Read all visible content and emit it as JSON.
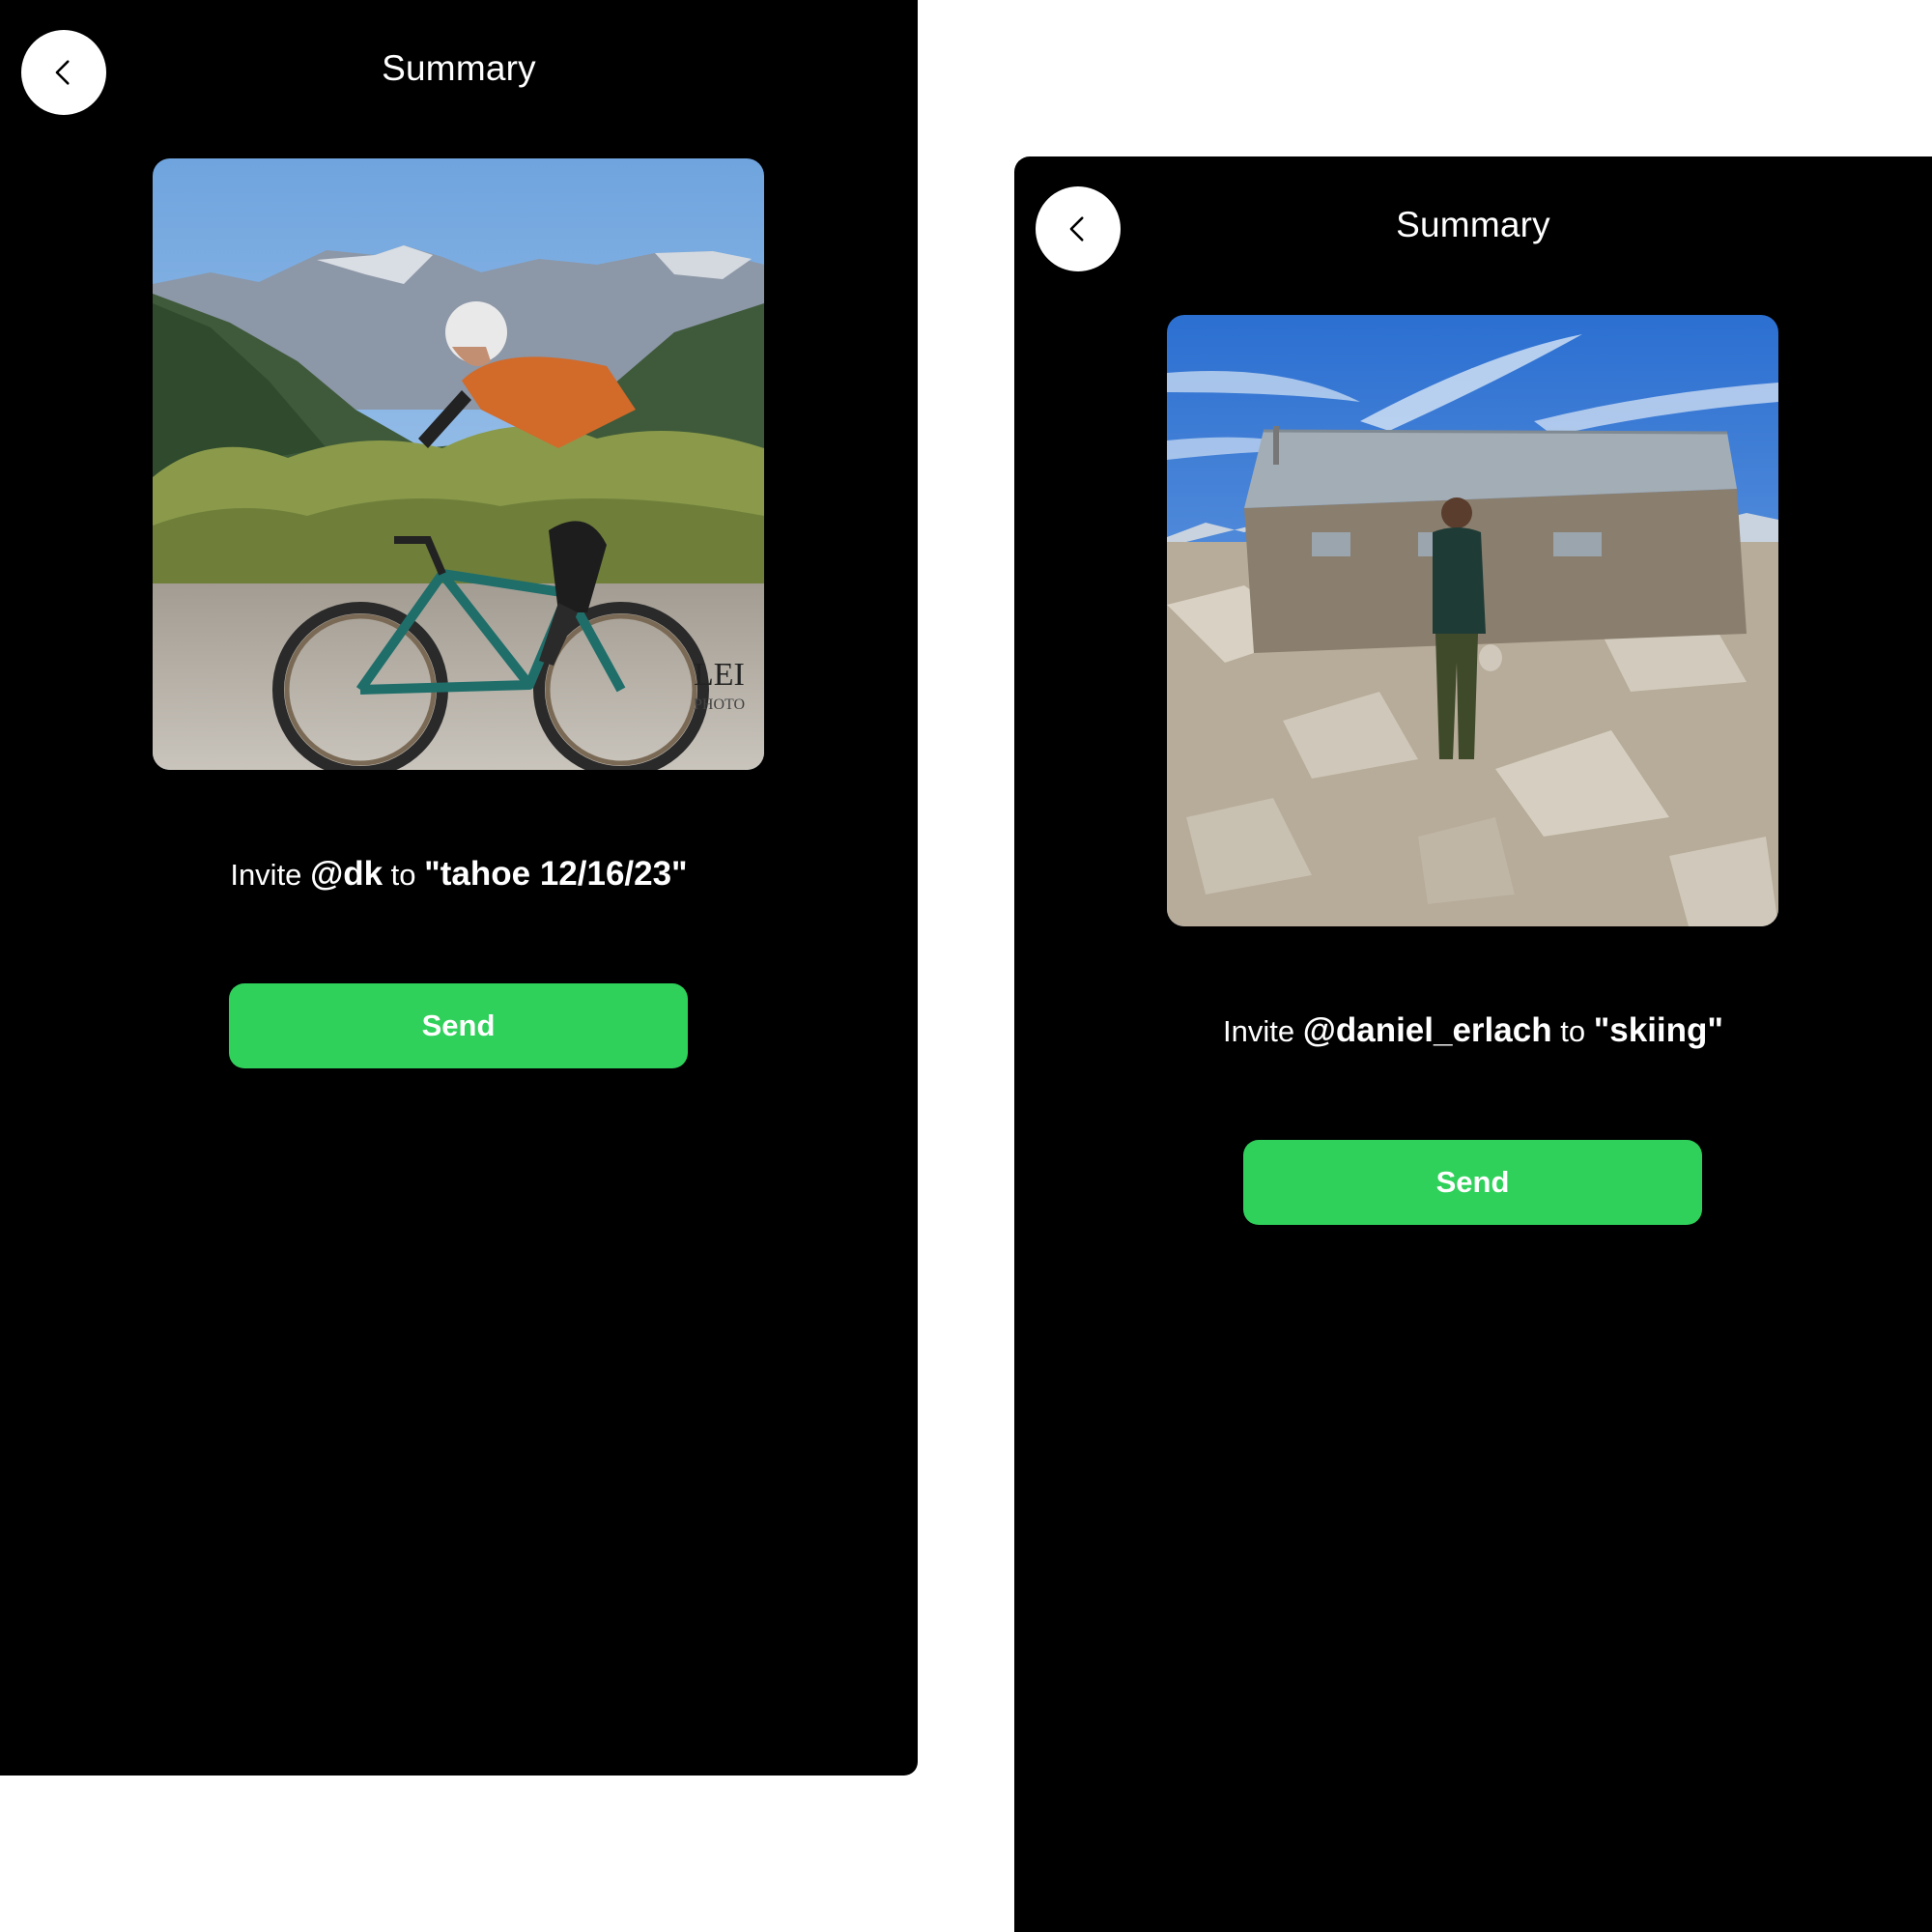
{
  "screens": [
    {
      "title": "Summary",
      "invite": {
        "prefix": "Invite",
        "user": "@dk",
        "connector": "to",
        "group": "\"tahoe 12/16/23\""
      },
      "send_label": "Send",
      "photo_watermark": "LEI PHOTO"
    },
    {
      "title": "Summary",
      "invite": {
        "prefix": "Invite",
        "user": "@daniel_erlach",
        "connector": "to",
        "group": "\"skiing\""
      },
      "send_label": "Send"
    }
  ],
  "colors": {
    "send_button": "#30d15b",
    "background": "#000000",
    "page": "#ffffff"
  },
  "icons": {
    "back": "chevron-left-icon"
  }
}
